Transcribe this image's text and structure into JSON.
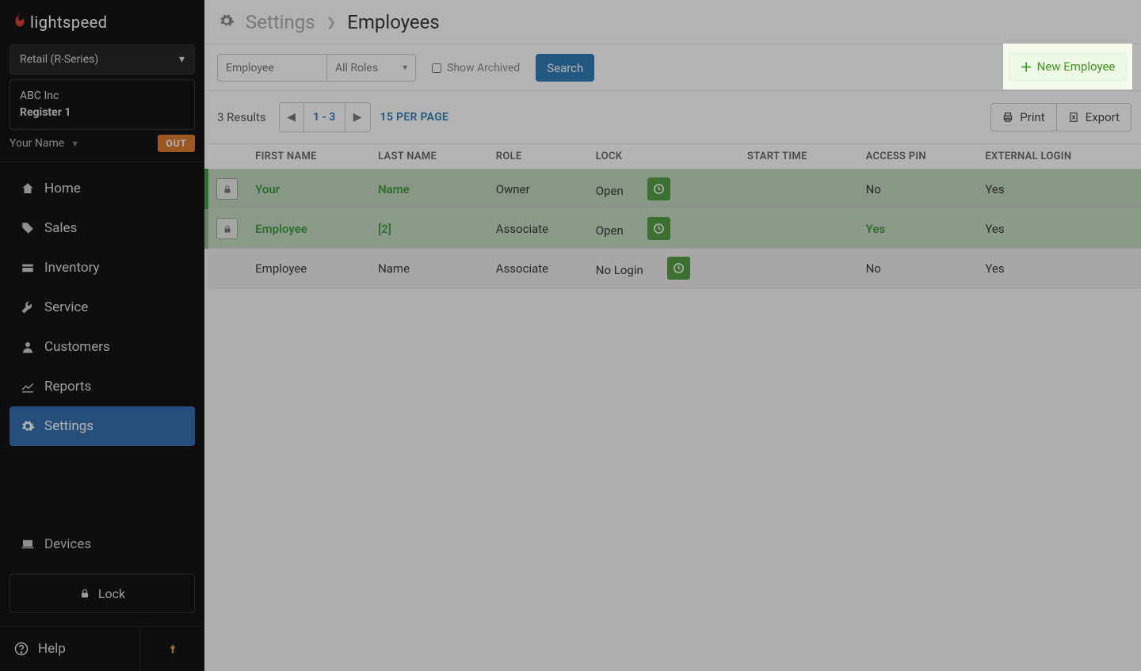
{
  "brand": "lightspeed",
  "sidebar": {
    "shop": "Retail (R-Series)",
    "account": {
      "company": "ABC Inc",
      "register": "Register 1"
    },
    "user": "Your Name",
    "out": "OUT",
    "items": [
      {
        "label": "Home",
        "icon": "home-icon"
      },
      {
        "label": "Sales",
        "icon": "tag-icon"
      },
      {
        "label": "Inventory",
        "icon": "folder-icon"
      },
      {
        "label": "Service",
        "icon": "wrench-icon"
      },
      {
        "label": "Customers",
        "icon": "user-icon"
      },
      {
        "label": "Reports",
        "icon": "chart-icon"
      },
      {
        "label": "Settings",
        "icon": "gear-icon"
      }
    ],
    "devices": "Devices",
    "lock": "Lock",
    "help": "Help"
  },
  "crumbs": {
    "parent": "Settings",
    "page": "Employees"
  },
  "toolbar": {
    "search_placeholder": "Employee",
    "role": "All Roles",
    "show_archived": "Show Archived",
    "search": "Search",
    "new_employee": "New Employee"
  },
  "subbar": {
    "results": "3 Results",
    "page": "1 - 3",
    "perpage": "15 PER PAGE",
    "print": "Print",
    "export": "Export"
  },
  "table": {
    "headers": {
      "first": "FIRST NAME",
      "last": "LAST NAME",
      "role": "ROLE",
      "lock": "LOCK",
      "start": "START TIME",
      "pin": "ACCESS PIN",
      "ext": "EXTERNAL LOGIN"
    },
    "rows": [
      {
        "locked": true,
        "first": "Your",
        "last": "Name",
        "role": "Owner",
        "lock": "Open",
        "pin": "No",
        "ext": "Yes",
        "link": true
      },
      {
        "locked": true,
        "first": "Employee",
        "last": "[2]",
        "role": "Associate",
        "lock": "Open",
        "pin": "Yes",
        "ext": "Yes",
        "link": true
      },
      {
        "locked": false,
        "first": "Employee",
        "last": "Name",
        "role": "Associate",
        "lock": "No Login",
        "pin": "No",
        "ext": "Yes",
        "link": false
      }
    ]
  }
}
